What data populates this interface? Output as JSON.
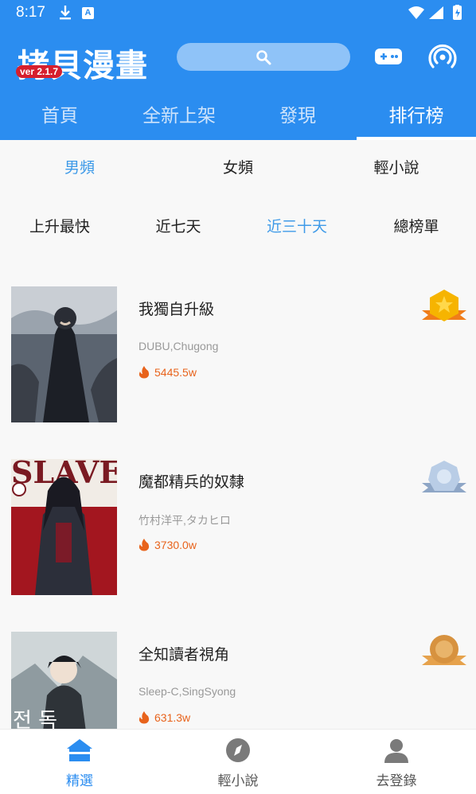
{
  "status": {
    "time": "8:17"
  },
  "header": {
    "logo": "拷貝漫畫",
    "version": "ver 2.1.7",
    "search_icon": "search-icon",
    "game_icon": "gamepad-icon",
    "signal_icon": "broadcast-icon"
  },
  "tabs": [
    {
      "label": "首頁"
    },
    {
      "label": "全新上架"
    },
    {
      "label": "發現"
    },
    {
      "label": "排行榜",
      "active": true
    }
  ],
  "category_tabs": [
    {
      "label": "男頻",
      "active": true
    },
    {
      "label": "女頻"
    },
    {
      "label": "輕小說"
    }
  ],
  "period_tabs": [
    {
      "label": "上升最快"
    },
    {
      "label": "近七天"
    },
    {
      "label": "近三十天",
      "active": true
    },
    {
      "label": "總榜單"
    }
  ],
  "ranking": [
    {
      "title": "我獨自升級",
      "author": "DUBU,Chugong",
      "hot": "5445.5w",
      "medal": "gold"
    },
    {
      "title": "魔都精兵的奴隸",
      "author": "竹村洋平,タカヒロ",
      "hot": "3730.0w",
      "medal": "silver"
    },
    {
      "title": "全知讀者視角",
      "author": "Sleep-C,SingSyong",
      "hot": "631.3w",
      "medal": "bronze"
    }
  ],
  "bottom_nav": [
    {
      "label": "精選",
      "icon": "home-icon",
      "active": true
    },
    {
      "label": "輕小說",
      "icon": "compass-icon"
    },
    {
      "label": "去登錄",
      "icon": "user-icon"
    }
  ],
  "colors": {
    "primary": "#2b8df0",
    "accent_text": "#3e9ae8",
    "hot": "#e8631c",
    "version_badge": "#d61f2e"
  }
}
